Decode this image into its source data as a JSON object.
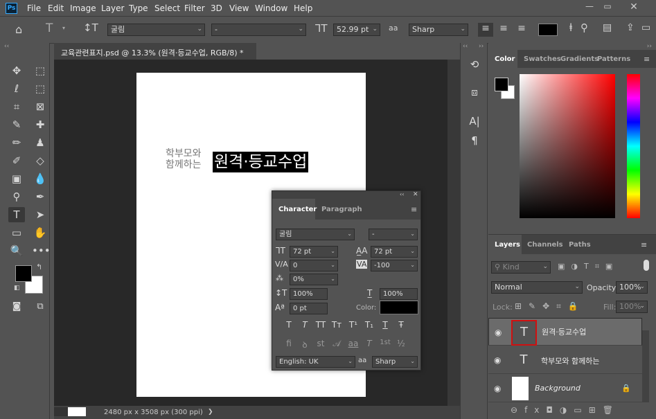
{
  "app": {
    "logo": "Ps"
  },
  "menu": [
    "File",
    "Edit",
    "Image",
    "Layer",
    "Type",
    "Select",
    "Filter",
    "3D",
    "View",
    "Window",
    "Help"
  ],
  "options": {
    "font_family": "굴림",
    "font_style": "-",
    "font_size": "52.99 pt",
    "antialias_icon": "aa",
    "antialias": "Sharp"
  },
  "document": {
    "tab_title": "교육관련표지.psd @ 13.3% (원격·등교수업, RGB/8) *",
    "close": "×",
    "status": "2480 px x 3508 px (300 ppi)",
    "status_arrow": "❯"
  },
  "canvas_text": {
    "small_line1": "학부모와",
    "small_line2": "함께하는",
    "big": "원격·등교수업"
  },
  "colors": {
    "foreground": "#000000",
    "background": "#ffffff",
    "accent": "#31a8ff",
    "selection": "#d01010"
  },
  "color_panel": {
    "tabs": [
      "Color",
      "Swatches",
      "Gradients",
      "Patterns"
    ]
  },
  "character": {
    "tabs": [
      "Character",
      "Paragraph"
    ],
    "font_family": "굴림",
    "font_style": "-",
    "size": "72 pt",
    "leading": "72 pt",
    "kerning": "0",
    "tracking": "-100",
    "tsume": "0%",
    "vscale": "100%",
    "hscale": "100%",
    "baseline": "0 pt",
    "color_label": "Color:",
    "style_buttons": [
      "T",
      "T",
      "TT",
      "Tт",
      "T¹",
      "T₁",
      "T",
      "Ŧ"
    ],
    "opentype_buttons": [
      "fi",
      "ꝺ",
      "st",
      "𝒜",
      "aa",
      "T",
      "1st",
      "½"
    ],
    "language": "English: UK",
    "aa_icon": "aa",
    "antialias": "Sharp"
  },
  "layers": {
    "tabs": [
      "Layers",
      "Channels",
      "Paths"
    ],
    "kind": "Kind",
    "blend": "Normal",
    "opacity_label": "Opacity:",
    "opacity": "100%",
    "lock_label": "Lock:",
    "fill_label": "Fill:",
    "fill": "100%",
    "items": [
      {
        "name": "원격·등교수업",
        "type": "text"
      },
      {
        "name": "학부모와 함께하는",
        "type": "text"
      },
      {
        "name": "Background",
        "type": "image"
      }
    ],
    "footer": [
      "⊖",
      "fx",
      "◘",
      "◑",
      "▭",
      "⊞",
      "🗑"
    ]
  }
}
